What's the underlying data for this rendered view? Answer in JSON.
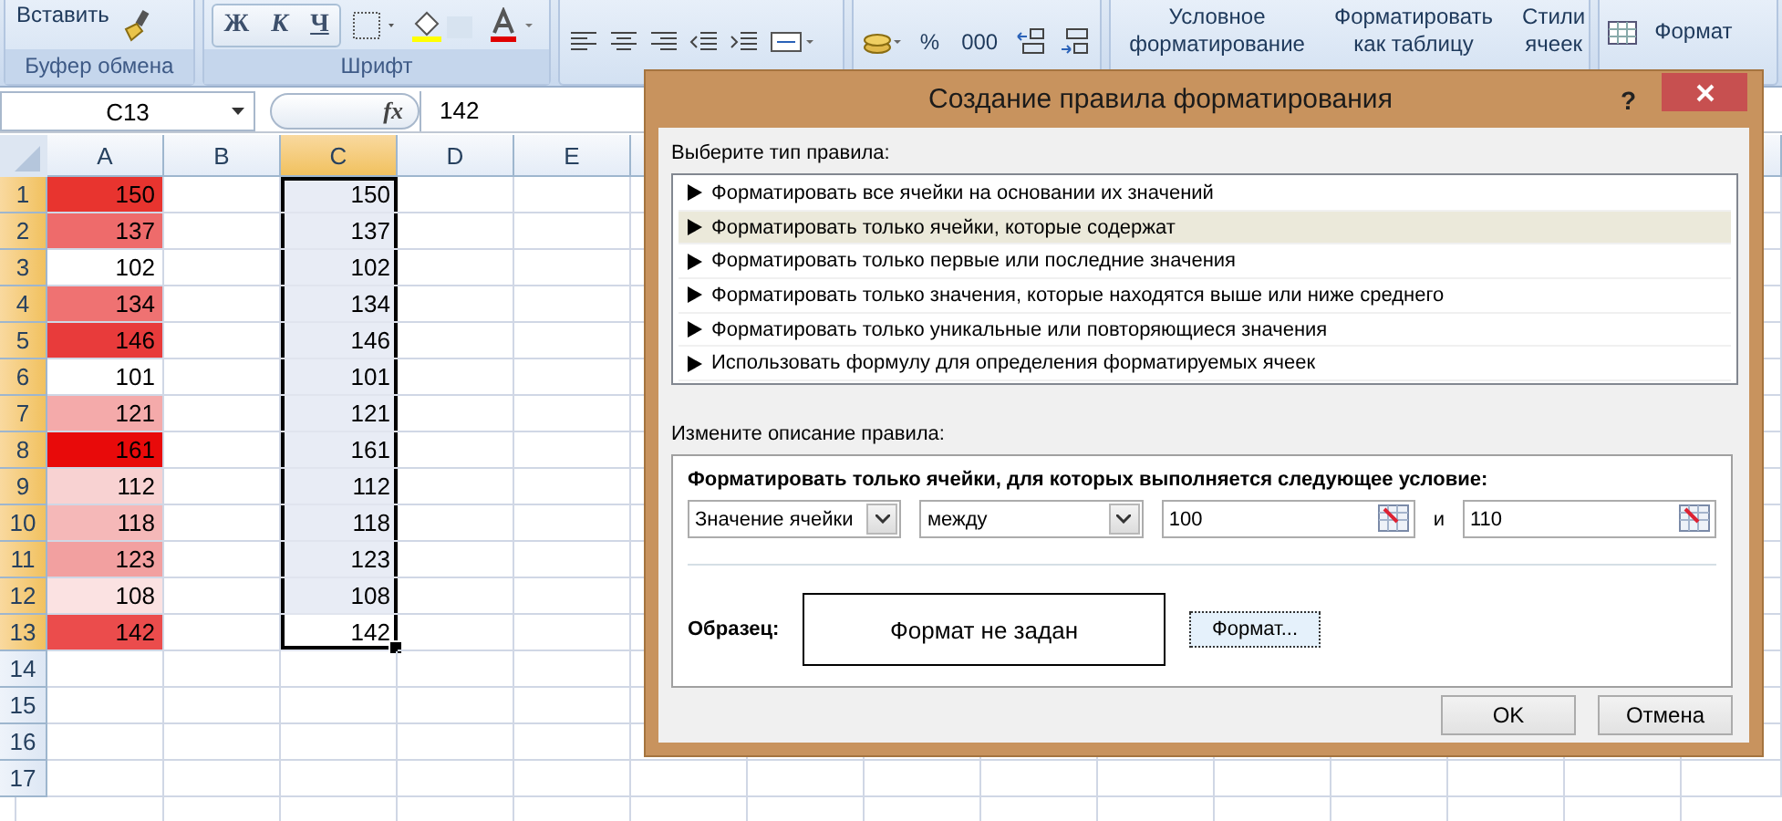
{
  "ribbon": {
    "clipboard": {
      "paste_button": "Вставить",
      "label": "Буфер обмена"
    },
    "font": {
      "buttons": [
        {
          "text": "Ж",
          "kind": "bold"
        },
        {
          "text": "К",
          "kind": "italic"
        },
        {
          "text": "Ч",
          "kind": "underline"
        }
      ],
      "label": "Шрифт"
    },
    "number": {
      "buttons": [
        "%",
        "000"
      ]
    },
    "styles": {
      "buttons": [
        {
          "lines": [
            "Условное",
            "форматирование"
          ]
        },
        {
          "lines": [
            "Форматировать",
            "как таблицу"
          ]
        },
        {
          "lines": [
            "Стили",
            "ячеек"
          ]
        }
      ]
    },
    "cells": {
      "format_button": "Формат"
    }
  },
  "formula_bar": {
    "name_box": "C13",
    "function_symbol": "fx",
    "value": "142"
  },
  "sheet": {
    "columns": [
      {
        "label": "A",
        "selected": false
      },
      {
        "label": "B",
        "selected": false
      },
      {
        "label": "C",
        "selected": true
      },
      {
        "label": "D",
        "selected": false
      },
      {
        "label": "E",
        "selected": false
      }
    ],
    "rows": [
      {
        "number": "1",
        "selected": true,
        "a": {
          "value": "150",
          "color": "#e8342f"
        },
        "c": {
          "value": "150",
          "selected": true,
          "active": false
        }
      },
      {
        "number": "2",
        "selected": true,
        "a": {
          "value": "137",
          "color": "#ee6b6b"
        },
        "c": {
          "value": "137",
          "selected": true,
          "active": false
        }
      },
      {
        "number": "3",
        "selected": true,
        "a": {
          "value": "102",
          "color": "#ffffff"
        },
        "c": {
          "value": "102",
          "selected": true,
          "active": false
        }
      },
      {
        "number": "4",
        "selected": true,
        "a": {
          "value": "134",
          "color": "#ef7272"
        },
        "c": {
          "value": "134",
          "selected": true,
          "active": false
        }
      },
      {
        "number": "5",
        "selected": true,
        "a": {
          "value": "146",
          "color": "#e83b3b"
        },
        "c": {
          "value": "146",
          "selected": true,
          "active": false
        }
      },
      {
        "number": "6",
        "selected": true,
        "a": {
          "value": "101",
          "color": "#ffffff"
        },
        "c": {
          "value": "101",
          "selected": true,
          "active": false
        }
      },
      {
        "number": "7",
        "selected": true,
        "a": {
          "value": "121",
          "color": "#f4aaaa"
        },
        "c": {
          "value": "121",
          "selected": true,
          "active": false
        }
      },
      {
        "number": "8",
        "selected": true,
        "a": {
          "value": "161",
          "color": "#e80a0a"
        },
        "c": {
          "value": "161",
          "selected": true,
          "active": false
        }
      },
      {
        "number": "9",
        "selected": true,
        "a": {
          "value": "112",
          "color": "#f8d2d2"
        },
        "c": {
          "value": "112",
          "selected": true,
          "active": false
        }
      },
      {
        "number": "10",
        "selected": true,
        "a": {
          "value": "118",
          "color": "#f5b8b8"
        },
        "c": {
          "value": "118",
          "selected": true,
          "active": false
        }
      },
      {
        "number": "11",
        "selected": true,
        "a": {
          "value": "123",
          "color": "#f2a0a0"
        },
        "c": {
          "value": "123",
          "selected": true,
          "active": false
        }
      },
      {
        "number": "12",
        "selected": true,
        "a": {
          "value": "108",
          "color": "#fbe2e2"
        },
        "c": {
          "value": "108",
          "selected": true,
          "active": false
        }
      },
      {
        "number": "13",
        "selected": true,
        "a": {
          "value": "142",
          "color": "#eb4c4c"
        },
        "c": {
          "value": "142",
          "selected": true,
          "active": true
        }
      },
      {
        "number": "14",
        "selected": false
      },
      {
        "number": "15",
        "selected": false
      },
      {
        "number": "16",
        "selected": false
      },
      {
        "number": "17",
        "selected": false
      }
    ]
  },
  "dialog": {
    "title": "Создание правила форматирования",
    "help": "?",
    "rule_type_label": "Выберите тип правила:",
    "rule_types": [
      {
        "text": "Форматировать все ячейки на основании их значений",
        "selected": false
      },
      {
        "text": "Форматировать только ячейки, которые содержат",
        "selected": true
      },
      {
        "text": "Форматировать только первые или последние значения",
        "selected": false
      },
      {
        "text": "Форматировать только значения, которые находятся выше или ниже среднего",
        "selected": false
      },
      {
        "text": "Форматировать только уникальные или повторяющиеся значения",
        "selected": false
      },
      {
        "text": "Использовать формулу для определения форматируемых ячеек",
        "selected": false
      }
    ],
    "description_label": "Измените описание правила:",
    "condition_heading": "Форматировать только ячейки, для которых выполняется следующее условие:",
    "condition": {
      "subject": "Значение ячейки",
      "operator": "между",
      "value_1": "100",
      "joiner": "и",
      "value_2": "110"
    },
    "preview_label": "Образец:",
    "preview_text": "Формат не задан",
    "format_button": "Формат...",
    "buttons": [
      "OK",
      "Отмена"
    ]
  }
}
